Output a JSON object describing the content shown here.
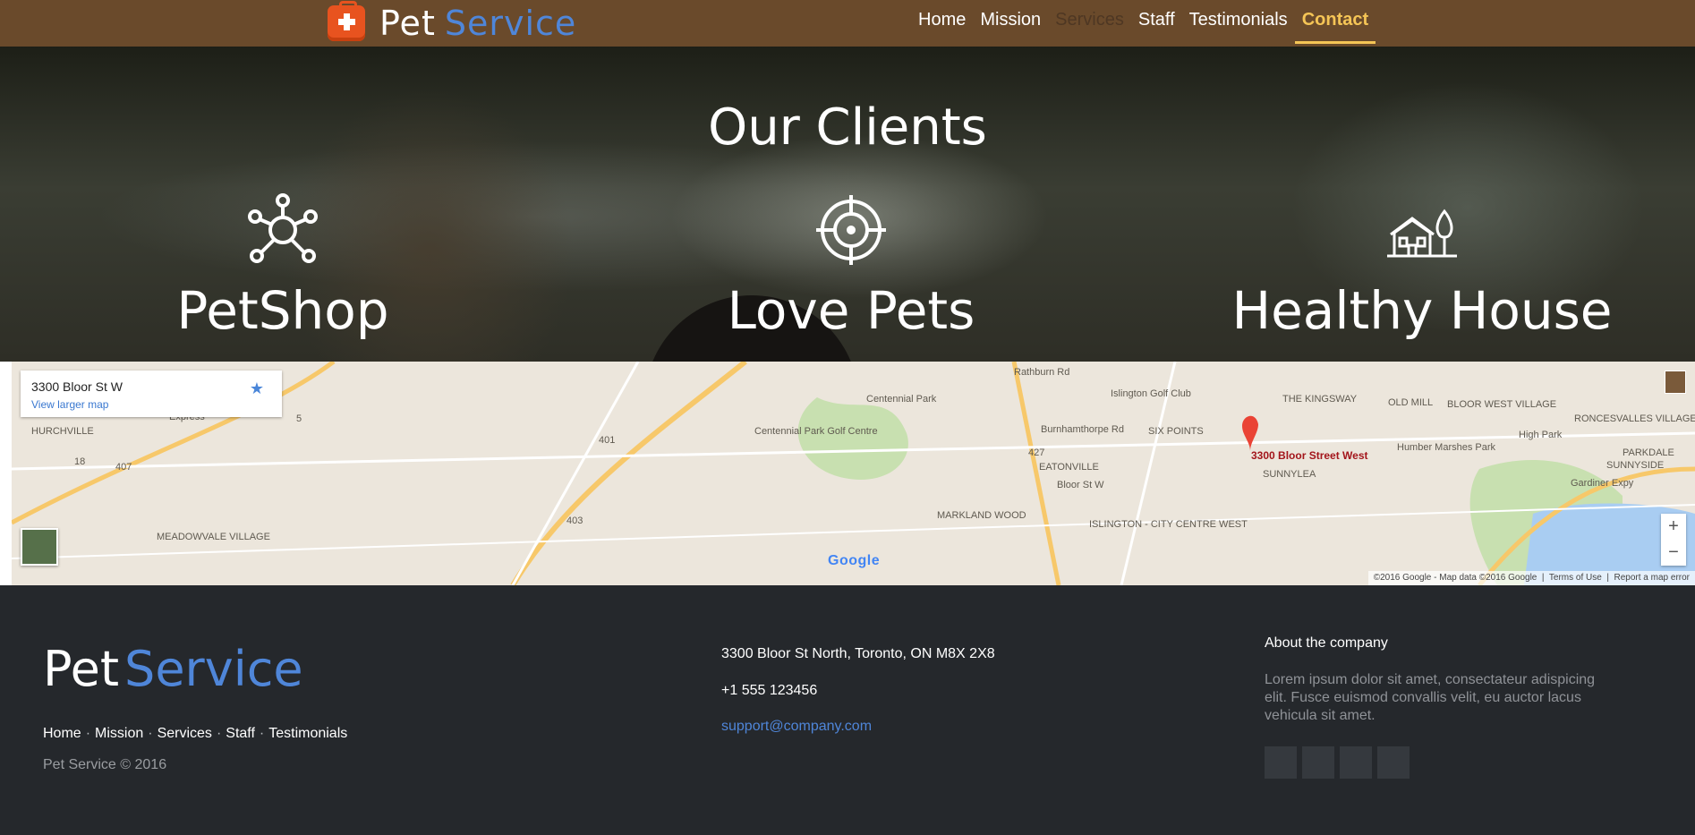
{
  "nav": {
    "brand_word1": "Pet",
    "brand_word2": "Service",
    "items": [
      {
        "label": "Home"
      },
      {
        "label": "Mission"
      },
      {
        "label": "Services"
      },
      {
        "label": "Staff"
      },
      {
        "label": "Testimonials"
      },
      {
        "label": "Contact"
      }
    ],
    "active": "Contact"
  },
  "hero": {
    "title": "Our Clients",
    "clients": [
      {
        "label": "PetShop",
        "icon": "network-icon"
      },
      {
        "label": "Love Pets",
        "icon": "target-icon"
      },
      {
        "label": "Healthy House",
        "icon": "house-icon"
      }
    ]
  },
  "map": {
    "card_address": "3300 Bloor St W",
    "card_link": "View larger map",
    "pin_label": "3300 Bloor Street West",
    "places": [
      "HURCHVILLE",
      "Centennial Park",
      "Centennial Park Golf Centre",
      "Islington Golf Club",
      "SIX POINTS",
      "EATONVILLE",
      "THE KINGSWAY",
      "OLD MILL",
      "BLOOR WEST VILLAGE",
      "RONCESVALLES VILLAGE",
      "High Park",
      "Humber Marshes Park",
      "SUNNYLEA",
      "PARKDALE",
      "SUNNYSIDE",
      "MARKLAND WOOD",
      "ISLINGTON - CITY CENTRE WEST",
      "MEADOWVALE VILLAGE",
      "Gardiner Expy",
      "Express",
      "Rathburn Rd",
      "Burnhamthorpe Rd",
      "Bloor St W",
      "401",
      "427",
      "403",
      "407",
      "18",
      "5"
    ],
    "zoom_in": "+",
    "zoom_out": "−",
    "google": "Google",
    "attribution": "©2016 Google - Map data ©2016 Google",
    "terms": "Terms of Use",
    "report": "Report a map error"
  },
  "footer": {
    "brand_word1": "Pet",
    "brand_word2": "Service",
    "links": [
      "Home",
      "Mission",
      "Services",
      "Staff",
      "Testimonials"
    ],
    "copyright": "Pet Service © 2016",
    "address": "3300 Bloor St North, Toronto, ON M8X 2X8",
    "phone": "+1 555 123456",
    "email": "support@company.com",
    "about_heading": "About the company",
    "about_text": "Lorem ipsum dolor sit amet, consectateur adispicing elit. Fusce euismod convallis velit, eu auctor lacus vehicula sit amet."
  },
  "colors": {
    "nav_bg": "#6a4a2b",
    "accent_blue": "#4f86d9",
    "active_link": "#f5c556",
    "footer_bg": "#25282c",
    "brand_icon": "#e8531f"
  }
}
